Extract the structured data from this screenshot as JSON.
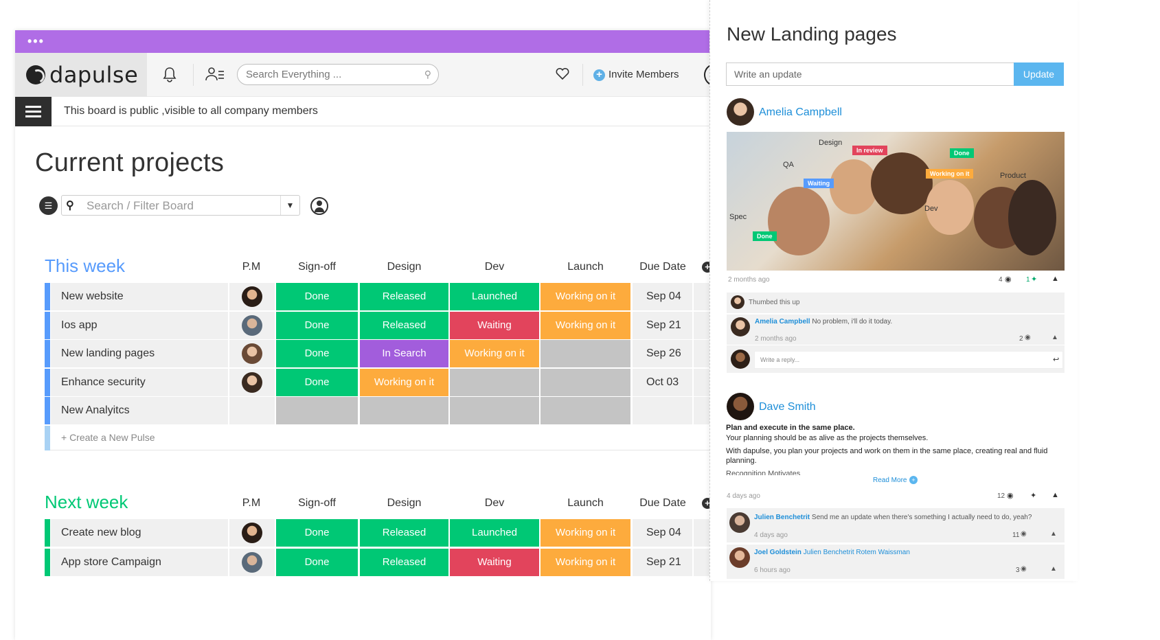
{
  "app": {
    "logo_text": "dapulse",
    "search_placeholder": "Search Everything ...",
    "invite_label": "Invite Members",
    "notice": "This board is public ,visible to all company members",
    "board_title": "Current projects",
    "filter_placeholder": "Search / Filter Board"
  },
  "columns": [
    "P.M",
    "Sign-off",
    "Design",
    "Dev",
    "Launch",
    "Due Date"
  ],
  "colors": {
    "done": "#00c875",
    "working": "#fdab3d",
    "waiting": "#e2445c",
    "in_search": "#a25ddc",
    "empty": "#c4c4c4",
    "this_week": "#579bfc",
    "next_week": "#00c875",
    "purple_bar": "#b06de6"
  },
  "groups": [
    {
      "title": "This week",
      "color_key": "this_week",
      "rows": [
        {
          "name": "New website",
          "signoff": "Done",
          "design": "Released",
          "dev": "Launched",
          "launch": "Working on it",
          "due": "Sep 04"
        },
        {
          "name": "Ios app",
          "signoff": "Done",
          "design": "Released",
          "dev": "Waiting",
          "launch": "Working on it",
          "due": "Sep 21"
        },
        {
          "name": "New landing pages",
          "signoff": "Done",
          "design": "In Search",
          "dev": "Working on it",
          "launch": "",
          "due": "Sep 26"
        },
        {
          "name": "Enhance security",
          "signoff": "Done",
          "design": "Working on it",
          "dev": "",
          "launch": "",
          "due": "Oct 03"
        },
        {
          "name": "New Analyitcs",
          "signoff": "",
          "design": "",
          "dev": "",
          "launch": "",
          "due": ""
        }
      ],
      "create_label": "+ Create a New Pulse"
    },
    {
      "title": "Next week",
      "color_key": "next_week",
      "rows": [
        {
          "name": "Create new blog",
          "signoff": "Done",
          "design": "Released",
          "dev": "Launched",
          "launch": "Working on it",
          "due": "Sep 04"
        },
        {
          "name": "App store Campaign",
          "signoff": "Done",
          "design": "Released",
          "dev": "Waiting",
          "launch": "Working on it",
          "due": "Sep 21"
        }
      ]
    }
  ],
  "side": {
    "title": "New Landing pages",
    "update_placeholder": "Write an update",
    "update_button": "Update",
    "post1": {
      "author": "Amelia Campbell",
      "time": "2 months ago",
      "views": "4",
      "thumbs": "1",
      "image_labels": [
        "Design",
        "In review",
        "QA",
        "Waiting",
        "Done",
        "Working on it",
        "Product",
        "Spec",
        "Done",
        "Dev"
      ],
      "thumbed": "Thumbed this up",
      "reply_author": "Amelia Campbell",
      "reply_text": "No problem, i'll do it today.",
      "reply_time": "2 months ago",
      "reply_views": "2",
      "reply_placeholder": "Write a reply..."
    },
    "post2": {
      "author": "Dave  Smith",
      "heading": "Plan and execute in the same place.",
      "line1": "Your planning should be as alive as the projects themselves.",
      "line2": "With dapulse, you plan your projects and work on them in the same place, creating real and fluid planning.",
      "line3": "Recognition Motivates",
      "read_more": "Read More",
      "time": "4 days ago",
      "views": "12",
      "c1_author": "Julien Benchetrit",
      "c1_text": "Send me an update when there's something I actually need to do, yeah?",
      "c1_time": "4 days ago",
      "c1_views": "11",
      "c2_author": "Joel Goldstein",
      "c2_text": "Julien Benchetrit Rotem Waissman",
      "c2_time": "6 hours ago",
      "c2_views": "3"
    }
  }
}
